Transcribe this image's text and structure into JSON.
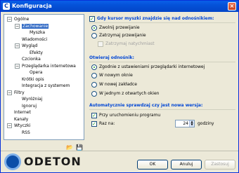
{
  "window": {
    "title": "Konfiguracja",
    "app_icon": "C",
    "close_glyph": "×"
  },
  "tree": {
    "items": [
      {
        "label": "Ogólne",
        "level": 0,
        "expander": "−"
      },
      {
        "label": "Zachowanie",
        "level": 1,
        "expander": "−",
        "selected": true
      },
      {
        "label": "Myszka",
        "level": 2
      },
      {
        "label": "Wiadomości",
        "level": 1
      },
      {
        "label": "Wygląd",
        "level": 1,
        "expander": "−"
      },
      {
        "label": "Efekty",
        "level": 2
      },
      {
        "label": "Czcionka",
        "level": 1
      },
      {
        "label": "Przeglądarka internetowa",
        "level": 1,
        "expander": "−"
      },
      {
        "label": "Opera",
        "level": 2
      },
      {
        "label": "Krótki opis",
        "level": 1
      },
      {
        "label": "Integracja z systemem",
        "level": 1
      },
      {
        "label": "Filtry",
        "level": 0,
        "expander": "−"
      },
      {
        "label": "Wyróżniaj",
        "level": 1
      },
      {
        "label": "Ignoruj",
        "level": 1
      },
      {
        "label": "Internet",
        "level": 0
      },
      {
        "label": "Kanały",
        "level": 0
      },
      {
        "label": "Wtyczki",
        "level": 0,
        "expander": "−"
      },
      {
        "label": "RSS",
        "level": 1
      }
    ]
  },
  "hover_group": {
    "checkbox_checked": true,
    "title": "Gdy kursor myszki znajdzie się nad odnośnikiem:",
    "options": [
      "Zwolnij przewijanie",
      "Zatrzymaj przewijanie"
    ],
    "selected": 0,
    "sub_option": "Zatrzymaj natychmiast"
  },
  "open_group": {
    "title": "Otwieraj odnośnik:",
    "options": [
      "Zgodnie z ustawieniami przeglądarki internetowej",
      "W nowym oknie",
      "W nowej zakładce",
      "W jednym z otwartych okien"
    ],
    "selected": 0
  },
  "update_group": {
    "title": "Automatycznie sprawdzaj czy jest nowa wersja:",
    "on_startup_label": "Przy uruchomieniu programu",
    "on_startup_checked": true,
    "interval_label": "Raz na:",
    "interval_checked": true,
    "interval_value": "24",
    "interval_unit": "godziny"
  },
  "footer": {
    "logo_text": "ODETON",
    "ok_label": "OK",
    "cancel_label": "Anuluj",
    "apply_label": "Zastosuj",
    "open_icon": "📂",
    "save_icon": "💾"
  }
}
